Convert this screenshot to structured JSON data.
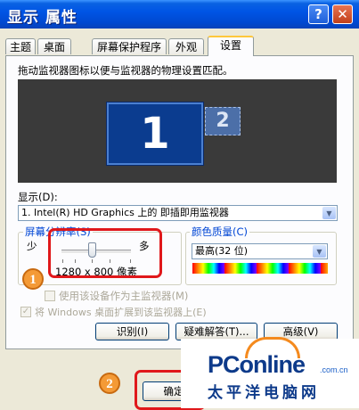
{
  "window": {
    "title": "显示 属性",
    "help_label": "?",
    "close_label": "✕"
  },
  "tabs": [
    {
      "label": "主题"
    },
    {
      "label": "桌面"
    },
    {
      "label": "屏幕保护程序"
    },
    {
      "label": "外观"
    },
    {
      "label": "设置"
    }
  ],
  "settings": {
    "description": "拖动监视器图标以便与监视器的物理设置匹配。",
    "monitor_primary": "1",
    "monitor_secondary": "2",
    "display_label": "显示(D):",
    "display_value": "1. Intel(R) HD Graphics 上的 即插即用监视器",
    "resolution_group": "屏幕分辨率(S)",
    "resolution_less": "少",
    "resolution_more": "多",
    "resolution_value": "1280 x 800 像素",
    "color_group": "颜色质量(C)",
    "color_value": "最高(32 位)",
    "primary_checkbox": "使用该设备作为主监视器(M)",
    "extend_checkbox": "将 Windows 桌面扩展到该监视器上(E)",
    "identify_button": "识别(I)",
    "troubleshoot_button": "疑难解答(T)...",
    "advanced_button": "高级(V)",
    "ok_button": "确定"
  },
  "annotations": {
    "step1": "1",
    "step2": "2"
  },
  "watermark": {
    "logo_main": "PConline",
    "domain": ".com.cn",
    "subtitle": "太平洋电脑网"
  },
  "colors": {
    "titlebar": "#0055E5",
    "annotation_red": "#E0181B",
    "annotation_badge": "#F49A36"
  }
}
